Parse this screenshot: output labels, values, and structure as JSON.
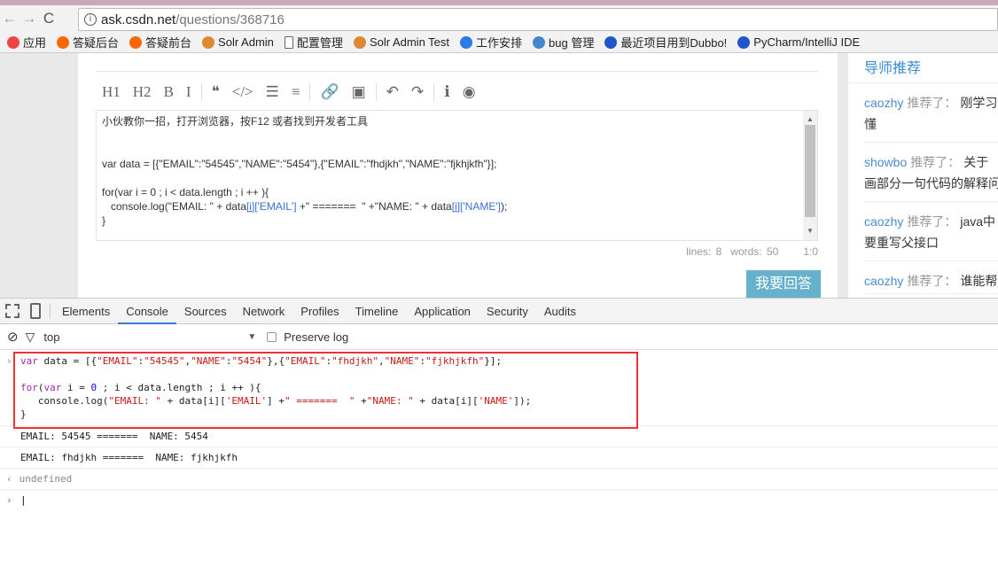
{
  "browser": {
    "url_host": "ask.csdn.net",
    "url_path": "/questions/368716",
    "bookmarks": [
      {
        "label": "应用",
        "icon": "apps-grid-icon",
        "color": "#e44"
      },
      {
        "label": "答疑后台",
        "icon": "csdn-icon",
        "color": "#f60"
      },
      {
        "label": "答疑前台",
        "icon": "csdn-icon",
        "color": "#f60"
      },
      {
        "label": "Solr Admin",
        "icon": "solr-icon",
        "color": "#d83"
      },
      {
        "label": "配置管理",
        "icon": "page-icon",
        "color": "#fff"
      },
      {
        "label": "Solr Admin Test",
        "icon": "solr-icon",
        "color": "#d83"
      },
      {
        "label": "工作安排",
        "icon": "drop-icon",
        "color": "#2a7be4"
      },
      {
        "label": "bug 管理",
        "icon": "globe-icon",
        "color": "#48c"
      },
      {
        "label": "最近项目用到Dubbo!",
        "icon": "site-icon",
        "color": "#25c"
      },
      {
        "label": "PyCharm/IntelliJ IDE",
        "icon": "site-icon",
        "color": "#25c"
      }
    ]
  },
  "editor": {
    "toolbar": [
      "H1",
      "H2",
      "B",
      "I",
      "❝",
      "</>",
      "☰",
      "≡",
      "🔗",
      "▣",
      "↶",
      "↷",
      "ℹ",
      "◉"
    ],
    "lines": [
      [
        {
          "t": "小伙教你一招，打开浏览器，按F12 或者找到开发者工具"
        }
      ],
      [],
      [],
      [
        {
          "t": "var data = [{\"EMAIL\":\"54545\",\"NAME\":\"5454\"},{\"EMAIL\":\"fhdjkh\",\"NAME\":\"fjkhjkfh\"}];"
        }
      ],
      [],
      [
        {
          "t": "for(var i = 0 ; i < data.length ; i ++ ){"
        }
      ],
      [
        {
          "t": "   console.log(\"EMAIL: \" + data"
        },
        {
          "t": "[i]",
          "c": "ed-u"
        },
        {
          "t": "['EMAIL']",
          "c": "ed-b"
        },
        {
          "t": " +\" =======  \" +\"NAME: \" + data"
        },
        {
          "t": "[i]",
          "c": "ed-u"
        },
        {
          "t": "['NAME']",
          "c": "ed-b"
        },
        {
          "t": ");"
        }
      ],
      [
        {
          "t": "}"
        }
      ]
    ],
    "lines_label": "lines: 8",
    "words_label": "words: 50",
    "cursor": "1:0",
    "answer_button": "我要回答"
  },
  "sidebar": {
    "title": "导师推荐",
    "items": [
      {
        "user": "caozhy",
        "verb": "推荐了：",
        "text": "刚学习",
        "text2": "懂"
      },
      {
        "user": "showbo",
        "verb": "推荐了：",
        "text": "关于",
        "text2": "画部分一句代码的解释问"
      },
      {
        "user": "caozhy",
        "verb": "推荐了：",
        "text": "java中",
        "text2": "要重写父接口"
      },
      {
        "user": "caozhy",
        "verb": "推荐了：",
        "text": "谁能帮",
        "text2": ""
      }
    ]
  },
  "devtools": {
    "tabs": [
      "Elements",
      "Console",
      "Sources",
      "Network",
      "Profiles",
      "Timeline",
      "Application",
      "Security",
      "Audits"
    ],
    "active_tab": "Console",
    "context": "top",
    "preserve_log": "Preserve log",
    "preserve_checked": false
  },
  "console": {
    "input_lines": [
      [
        {
          "t": "var",
          "c": "k"
        },
        {
          "t": " data = [{"
        },
        {
          "t": "\"EMAIL\"",
          "c": "s"
        },
        {
          "t": ":"
        },
        {
          "t": "\"54545\"",
          "c": "s"
        },
        {
          "t": ","
        },
        {
          "t": "\"NAME\"",
          "c": "s"
        },
        {
          "t": ":"
        },
        {
          "t": "\"5454\"",
          "c": "s"
        },
        {
          "t": "},{"
        },
        {
          "t": "\"EMAIL\"",
          "c": "s"
        },
        {
          "t": ":"
        },
        {
          "t": "\"fhdjkh\"",
          "c": "s"
        },
        {
          "t": ","
        },
        {
          "t": "\"NAME\"",
          "c": "s"
        },
        {
          "t": ":"
        },
        {
          "t": "\"fjkhjkfh\"",
          "c": "s"
        },
        {
          "t": "}];"
        }
      ],
      [],
      [
        {
          "t": "for",
          "c": "k"
        },
        {
          "t": "("
        },
        {
          "t": "var",
          "c": "k"
        },
        {
          "t": " i = "
        },
        {
          "t": "0",
          "c": "n"
        },
        {
          "t": " ; i < data.length ; i ++ ){"
        }
      ],
      [
        {
          "t": "   console.log("
        },
        {
          "t": "\"EMAIL: \"",
          "c": "s"
        },
        {
          "t": " + data[i]["
        },
        {
          "t": "'EMAIL'",
          "c": "s"
        },
        {
          "t": "] +"
        },
        {
          "t": "\" =======  \"",
          "c": "s"
        },
        {
          "t": " +"
        },
        {
          "t": "\"NAME: \"",
          "c": "s"
        },
        {
          "t": " + data[i]["
        },
        {
          "t": "'NAME'",
          "c": "s"
        },
        {
          "t": "]);"
        }
      ],
      [
        {
          "t": "}"
        }
      ]
    ],
    "outputs": [
      "EMAIL: 54545 =======  NAME: 5454",
      "EMAIL: fhdjkh =======  NAME: fjkhjkfh"
    ],
    "return_value": "undefined"
  }
}
